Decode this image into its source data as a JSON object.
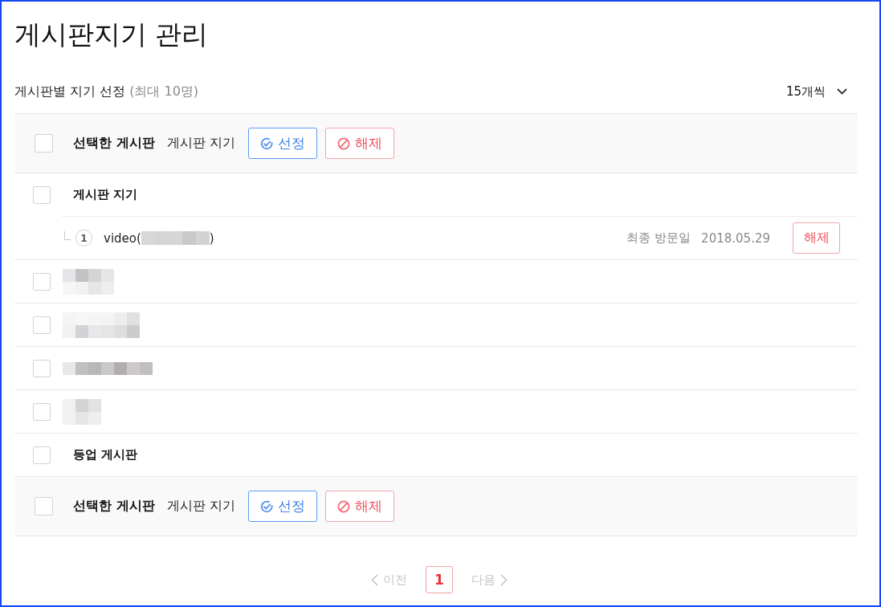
{
  "page": {
    "title": "게시판지기 관리"
  },
  "section": {
    "title": "게시판별 지기 선정",
    "note": "(최대 10명)",
    "page_size": "15개씩"
  },
  "top_action_bar": {
    "checked": false,
    "selected_label": "선택한 게시판",
    "role_label": "게시판 지기",
    "buttons": [
      {
        "kind": "assign",
        "label": "선정"
      },
      {
        "kind": "release",
        "label": "해제"
      }
    ]
  },
  "boards": [
    {
      "kind": "board",
      "checked": false,
      "name": "게시판 지기",
      "children": [
        {
          "number": "1",
          "name_prefix": "video(",
          "name_suffix": ")",
          "last_visit_label": "최종 방문일",
          "last_visit": "2018.05.29",
          "button": "해제"
        }
      ]
    },
    {
      "kind": "redacted",
      "checked": false
    },
    {
      "kind": "redacted",
      "checked": false
    },
    {
      "kind": "redacted",
      "checked": false
    },
    {
      "kind": "redacted",
      "checked": false
    },
    {
      "kind": "board",
      "checked": false,
      "name": "등업 게시판"
    }
  ],
  "bottom_action_bar": {
    "checked": false,
    "selected_label": "선택한 게시판",
    "role_label": "게시판 지기",
    "buttons": [
      {
        "kind": "assign",
        "label": "선정"
      },
      {
        "kind": "release",
        "label": "해제"
      }
    ]
  },
  "pagination": {
    "prev": {
      "label": "이전",
      "disabled": true
    },
    "pages": [
      {
        "label": "1",
        "selected": true
      }
    ],
    "next": {
      "label": "다음",
      "disabled": true
    }
  }
}
